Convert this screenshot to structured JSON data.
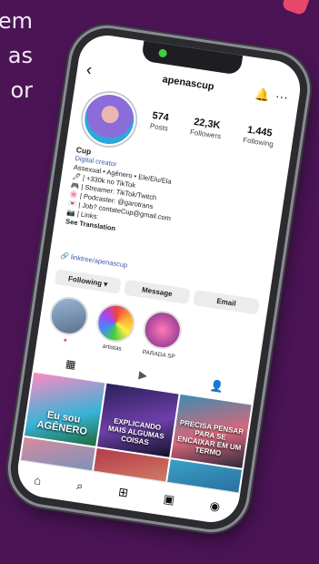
{
  "background_text": {
    "lines": [
      "em",
      "as",
      "or"
    ]
  },
  "profile": {
    "username": "apenascup",
    "back_icon": "chevron-left-icon",
    "bell_icon": "bell-icon",
    "more_icon": "more-horizontal-icon",
    "stats": [
      {
        "value": "574",
        "label": "Posts"
      },
      {
        "value": "22,3K",
        "label": "Followers"
      },
      {
        "value": "1.445",
        "label": "Following"
      }
    ],
    "bio": {
      "name": "Cup",
      "category": "Digital creator",
      "lines": [
        "Assexual • Agênero • Ele/Elu/Ela",
        "🖊 | +330k no TikTok",
        "🎮 | Streamer: TikTok/Twitch",
        "🌸 | Podcaster: @garotrans",
        "💌 | Job? contateCup@gmail.com",
        "📷 | Links:"
      ],
      "see_translation": "See Translation",
      "link": "linktree/apenascup"
    },
    "buttons": {
      "following": "Following ▾",
      "message": "Message",
      "email": "Email"
    },
    "highlights": [
      {
        "label": "♥"
      },
      {
        "label": "artistas"
      },
      {
        "label": "PARADA SP"
      }
    ],
    "tabs": [
      "grid-icon",
      "reels-icon",
      "tagged-icon"
    ],
    "grid_posts": [
      {
        "caption": "Eu sou AGÊNERO",
        "big": true
      },
      {
        "caption": "EXPLICANDO MAIS ALGUMAS COISAS",
        "big": false
      },
      {
        "caption": "PRECISA PENSAR PARA SE ENCAIXAR EM UM TERMO",
        "big": false
      },
      {
        "caption": "",
        "big": false
      },
      {
        "caption": "",
        "big": false
      },
      {
        "caption": "",
        "big": false
      }
    ],
    "bottom_nav": [
      "home-icon",
      "search-icon",
      "add-icon",
      "reels-icon",
      "profile-icon"
    ]
  }
}
